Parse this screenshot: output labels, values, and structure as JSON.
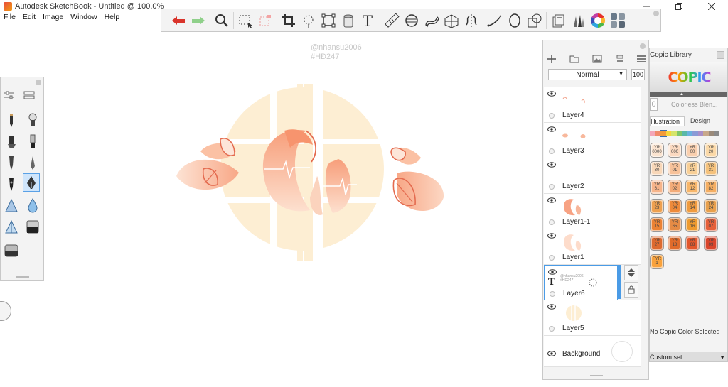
{
  "window": {
    "title": "Autodesk SketchBook - Untitled @ 100.0%"
  },
  "menu": [
    "File",
    "Edit",
    "Image",
    "Window",
    "Help"
  ],
  "toolbar": {
    "tools": [
      "undo-icon",
      "redo-icon",
      "zoom-icon",
      "select-icon",
      "transform-select-icon",
      "crop-icon",
      "lasso-icon",
      "distort-icon",
      "fill-icon",
      "text-icon",
      "ruler-icon",
      "ellipse-guide-icon",
      "french-curve-icon",
      "perspective-icon",
      "symmetry-icon",
      "stroke-icon",
      "circle-icon",
      "shapes-icon",
      "copic-icon",
      "brushes-icon",
      "color-wheel-icon",
      "palette-icon"
    ]
  },
  "canvas": {
    "watermark_line1": "@nhansu2006",
    "watermark_line2": "#HĐ247"
  },
  "layers_panel": {
    "blend_mode": "Normal",
    "opacity": "100",
    "layers": [
      {
        "name": "Layer4"
      },
      {
        "name": "Layer3"
      },
      {
        "name": "Layer2"
      },
      {
        "name": "Layer1-1"
      },
      {
        "name": "Layer1"
      },
      {
        "name": "Layer6",
        "text_line1": "@nhansu2006",
        "text_line2": "#HĐ247",
        "selected": true
      },
      {
        "name": "Layer5"
      },
      {
        "name": "Background"
      }
    ]
  },
  "copic": {
    "title": "Copic Library",
    "logo": "COPIC",
    "selected_name": "Colorless Blen...",
    "selected_code": "0",
    "tabs": [
      "Illustration",
      "Design"
    ],
    "status": "No Copic Color Selected",
    "set": "Custom set",
    "swatches": [
      {
        "code": "YR 0000",
        "color": "#fbe4d0"
      },
      {
        "code": "YR 000",
        "color": "#fbd9c0"
      },
      {
        "code": "YR 00",
        "color": "#f9cfae"
      },
      {
        "code": "YR 20",
        "color": "#fbd9a8"
      },
      {
        "code": "YR 30",
        "color": "#f8d7b8"
      },
      {
        "code": "YR 01",
        "color": "#f7c29a"
      },
      {
        "code": "YR 21",
        "color": "#f8cf96"
      },
      {
        "code": "YR 31",
        "color": "#f5c27c"
      },
      {
        "code": "YR 61",
        "color": "#f6b48a"
      },
      {
        "code": "YR 02",
        "color": "#f3ab78"
      },
      {
        "code": "YR 12",
        "color": "#f7b66a"
      },
      {
        "code": "YR 82",
        "color": "#f4ae62"
      },
      {
        "code": "YR 23",
        "color": "#eea04f"
      },
      {
        "code": "YR 04",
        "color": "#ee8a3a"
      },
      {
        "code": "YR 14",
        "color": "#f09b3e"
      },
      {
        "code": "YR 24",
        "color": "#e8a04c"
      },
      {
        "code": "YR 15",
        "color": "#eb8234"
      },
      {
        "code": "YR 65",
        "color": "#e58b45"
      },
      {
        "code": "YR 16",
        "color": "#ee9a2e"
      },
      {
        "code": "YR 07",
        "color": "#e5603a"
      },
      {
        "code": "YR 27",
        "color": "#dd6a2f"
      },
      {
        "code": "YR 18",
        "color": "#e06b2a"
      },
      {
        "code": "YR 68",
        "color": "#e2562b"
      },
      {
        "code": "YR 09",
        "color": "#d9452b"
      },
      {
        "code": "FYR 1",
        "color": "#f9a23c"
      }
    ]
  }
}
